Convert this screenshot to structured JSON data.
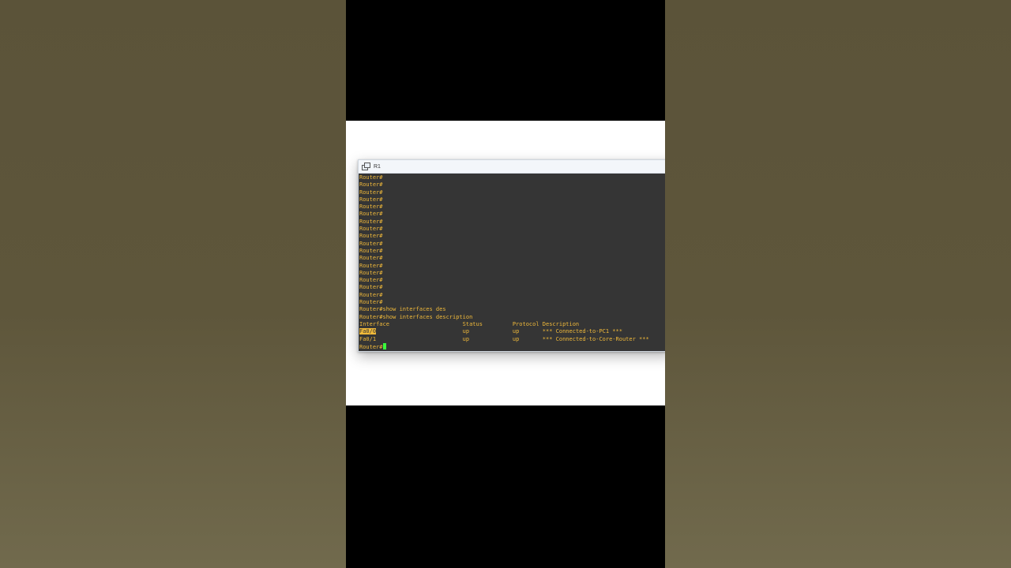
{
  "window": {
    "title": "R1"
  },
  "terminal": {
    "prompt_lines": [
      "Router#",
      "Router#",
      "Router#",
      "Router#",
      "Router#",
      "Router#",
      "Router#",
      "Router#",
      "Router#",
      "Router#",
      "Router#",
      "Router#",
      "Router#",
      "Router#",
      "Router#",
      "Router#",
      "Router#",
      "Router#"
    ],
    "command_1": "Router#show interfaces des",
    "command_2": "Router#show interfaces description",
    "table_header": "Interface                      Status         Protocol Description",
    "rows": [
      {
        "interface": "Fa0/0",
        "rest": "                          up             up       *** Connected-to-PC1 ***"
      },
      {
        "interface": "Fa0/1",
        "rest": "                          up             up       *** Connected-to-Core-Router ***"
      }
    ],
    "final_prompt": "Router#"
  }
}
